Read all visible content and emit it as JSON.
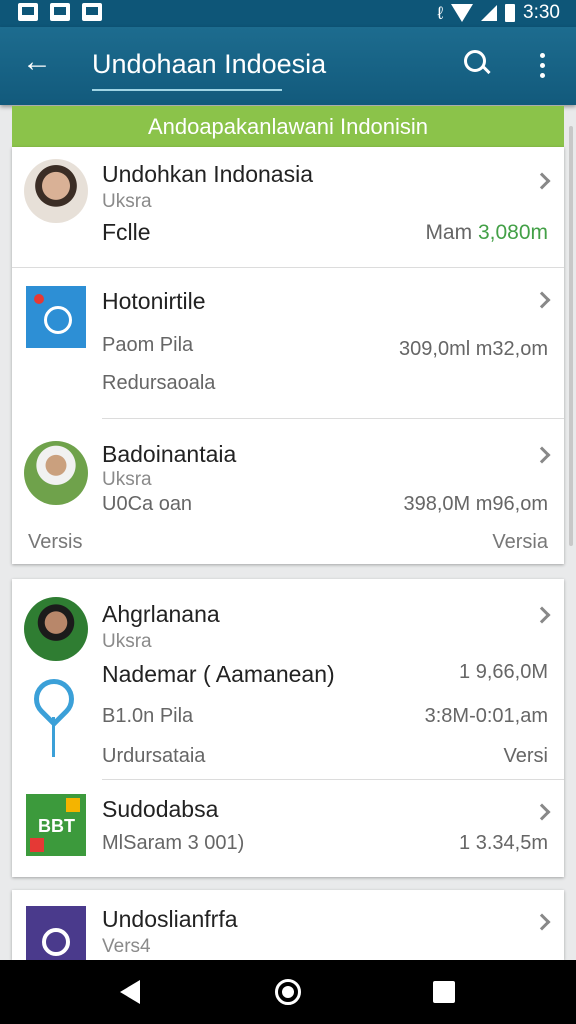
{
  "status_bar": {
    "time": "3:30"
  },
  "app_bar": {
    "title": "Undohaan Indoesia"
  },
  "banner": {
    "text": "Andoapakanlawani Indonisin"
  },
  "cards": [
    {
      "rows": [
        {
          "title": "Undohkan Indonasia",
          "subtitle": "Uksra",
          "line3": "Fclle",
          "right_prefix": "Mam",
          "right_value": "3,080m"
        },
        {
          "title": "Hotonirtile",
          "line2": "Paom Pila",
          "line3": "Redursaoala",
          "right_value": "309,0ml m32,om"
        },
        {
          "title": "Badoinantaia",
          "subtitle": "Uksra",
          "line2": "U0Ca oan",
          "right_value": "398,0M m96,om",
          "footer_left": "Versis",
          "footer_right": "Versia"
        }
      ]
    },
    {
      "rows": [
        {
          "title": "Ahgrlanana",
          "subtitle": "Uksra",
          "line2": "Nademar ( Aamanean)",
          "line3": "B1.0n Pila",
          "line4": "Urdursataia",
          "right_line2": "1 9,66,0M",
          "right_line3": "3:8M-0:01,am",
          "right_line4": "Versi"
        },
        {
          "title": "Sudodabsa",
          "subtitle": "MlSaram 3 001)",
          "right_value": "1 3.34,5m",
          "icon_label": "BBT"
        }
      ]
    },
    {
      "rows": [
        {
          "title": "Undoslianfrfa",
          "subtitle": "Vers4"
        }
      ]
    }
  ],
  "colors": {
    "app_bar": "#135c7e",
    "banner": "#8bc34a",
    "accent_green": "#43a047"
  }
}
